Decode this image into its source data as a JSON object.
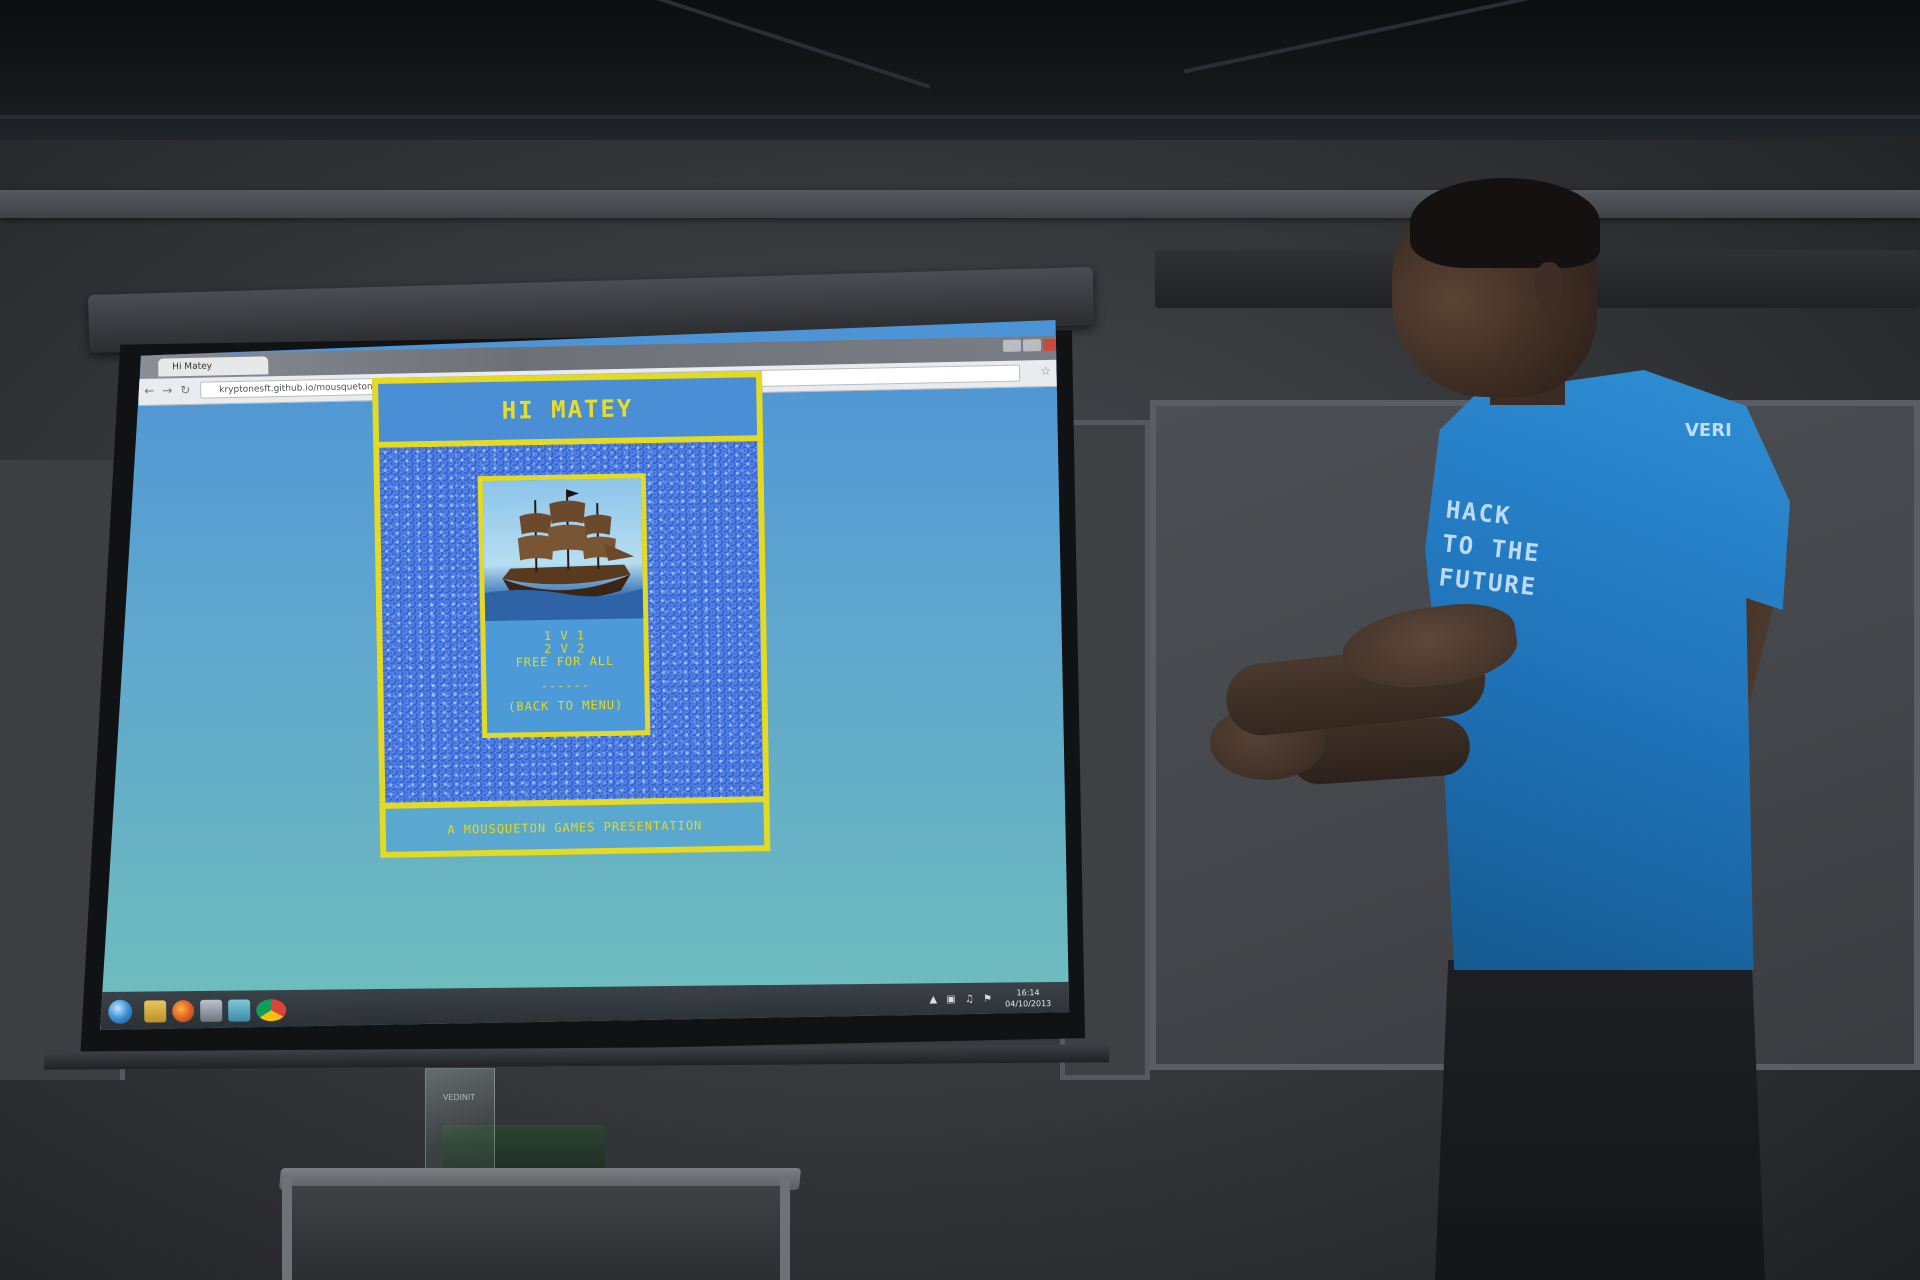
{
  "browser": {
    "tab_title": "Hi Matey",
    "url": "kryptonesft.github.io/mousqueton/start.html"
  },
  "game": {
    "title": "HI MATEY",
    "menu_options": [
      "1 V 1",
      "2 V 2",
      "FREE FOR ALL"
    ],
    "separator": "------",
    "back_option": "(BACK TO MENU)",
    "footer": "A MOUSQUETON GAMES PRESENTATION"
  },
  "taskbar": {
    "clock_time": "16:14",
    "clock_date": "04/10/2013",
    "icons": [
      "windows-start-icon",
      "folder-icon",
      "firefox-icon",
      "media-player-icon",
      "window-icon",
      "chrome-icon"
    ]
  },
  "shirt": {
    "slogan_lines": [
      "HACK",
      "TO THE",
      "FUTURE"
    ],
    "brand": "VERI"
  },
  "trophy_label": "VEDINIT",
  "colors": {
    "projection_blue": "#4c93d6",
    "menu_yellow": "#e4d923",
    "shirt_blue": "#1f72b8",
    "wall_gray": "#3a3c40"
  }
}
